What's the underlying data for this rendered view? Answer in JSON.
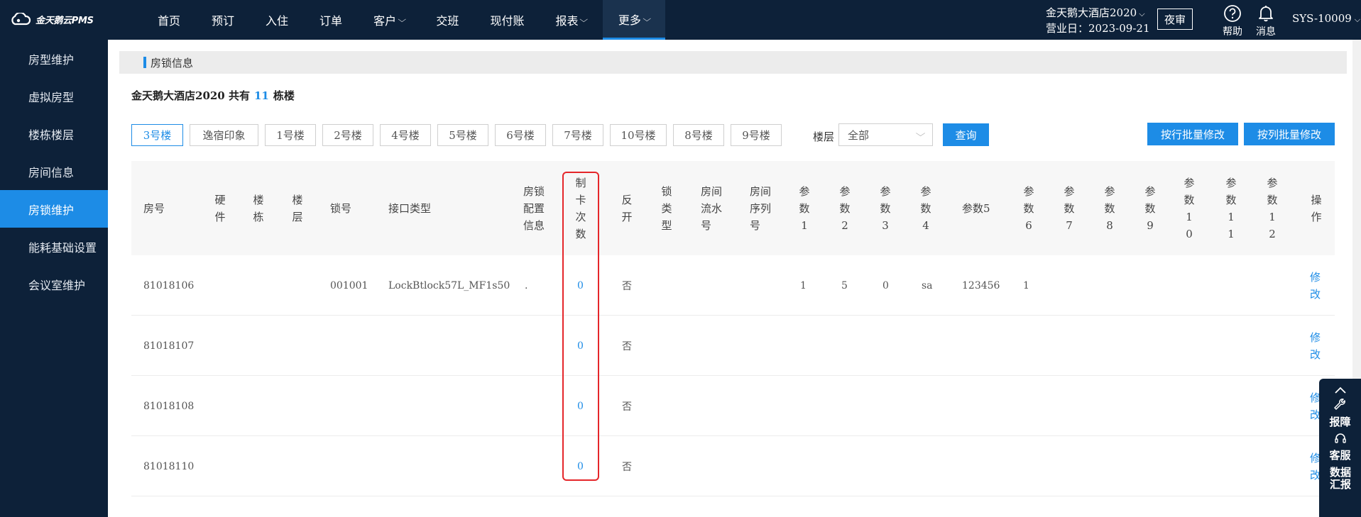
{
  "brand": {
    "logo_text": "金天鹅云PMS"
  },
  "nav": [
    {
      "label": "首页",
      "chev": ""
    },
    {
      "label": "预订",
      "chev": ""
    },
    {
      "label": "入住",
      "chev": ""
    },
    {
      "label": "订单",
      "chev": ""
    },
    {
      "label": "客户",
      "chev": "⌵"
    },
    {
      "label": "交班",
      "chev": ""
    },
    {
      "label": "现付账",
      "chev": ""
    },
    {
      "label": "报表",
      "chev": "⌵"
    },
    {
      "label": "更多",
      "chev": "⌵"
    }
  ],
  "header": {
    "hotel_name": "金天鹅大酒店2020",
    "business_day": "营业日：2023-09-21",
    "night_audit": "夜审",
    "help": "帮助",
    "messages": "消息",
    "user": "SYS-10009"
  },
  "sidebar": [
    {
      "label": "房型维护"
    },
    {
      "label": "虚拟房型"
    },
    {
      "label": "楼栋楼层"
    },
    {
      "label": "房间信息"
    },
    {
      "label": "房锁维护"
    },
    {
      "label": "能耗基础设置"
    },
    {
      "label": "会议室维护"
    }
  ],
  "section_title": "房锁信息",
  "summary": {
    "prefix": "金天鹅大酒店2020 共有",
    "count": "11",
    "suffix": "栋楼"
  },
  "buildings": [
    "3号楼",
    "逸宿印象",
    "1号楼",
    "2号楼",
    "4号楼",
    "5号楼",
    "6号楼",
    "7号楼",
    "10号楼",
    "8号楼",
    "9号楼"
  ],
  "filters": {
    "floor_label": "楼层",
    "floor_value": "全部",
    "query_btn": "查询",
    "batch_row_btn": "按行批量修改",
    "batch_col_btn": "按列批量修改"
  },
  "table": {
    "columns": [
      "房号",
      "硬件",
      "楼栋",
      "楼层",
      "锁号",
      "接口类型",
      "房锁配置信息",
      "制卡次数",
      "反开",
      "锁类型",
      "房间流水号",
      "房间序列号",
      "参数1",
      "参数2",
      "参数3",
      "参数4",
      "参数5",
      "参数6",
      "参数7",
      "参数8",
      "参数9",
      "参数10",
      "参数11",
      "参数12",
      "操作"
    ],
    "rows": [
      {
        "room": "81018106",
        "lock_no": "001001",
        "interface": "LockBtlock57L_MF1s50",
        "config": ".",
        "card_count": "0",
        "reverse": "否",
        "p1": "1",
        "p2": "5",
        "p3": "0",
        "p4": "sa",
        "p5": "123456",
        "p6": "1",
        "action": "修改"
      },
      {
        "room": "81018107",
        "lock_no": "",
        "interface": "",
        "config": "",
        "card_count": "0",
        "reverse": "否",
        "p1": "",
        "p2": "",
        "p3": "",
        "p4": "",
        "p5": "",
        "p6": "",
        "action": "修改"
      },
      {
        "room": "81018108",
        "lock_no": "",
        "interface": "",
        "config": "",
        "card_count": "0",
        "reverse": "否",
        "p1": "",
        "p2": "",
        "p3": "",
        "p4": "",
        "p5": "",
        "p6": "",
        "action": "修改"
      },
      {
        "room": "81018110",
        "lock_no": "",
        "interface": "",
        "config": "",
        "card_count": "0",
        "reverse": "否",
        "p1": "",
        "p2": "",
        "p3": "",
        "p4": "",
        "p5": "",
        "p6": "",
        "action": "修改"
      }
    ]
  },
  "float_panel": {
    "report": "报障",
    "service": "客服",
    "data_report": "数据汇报"
  }
}
